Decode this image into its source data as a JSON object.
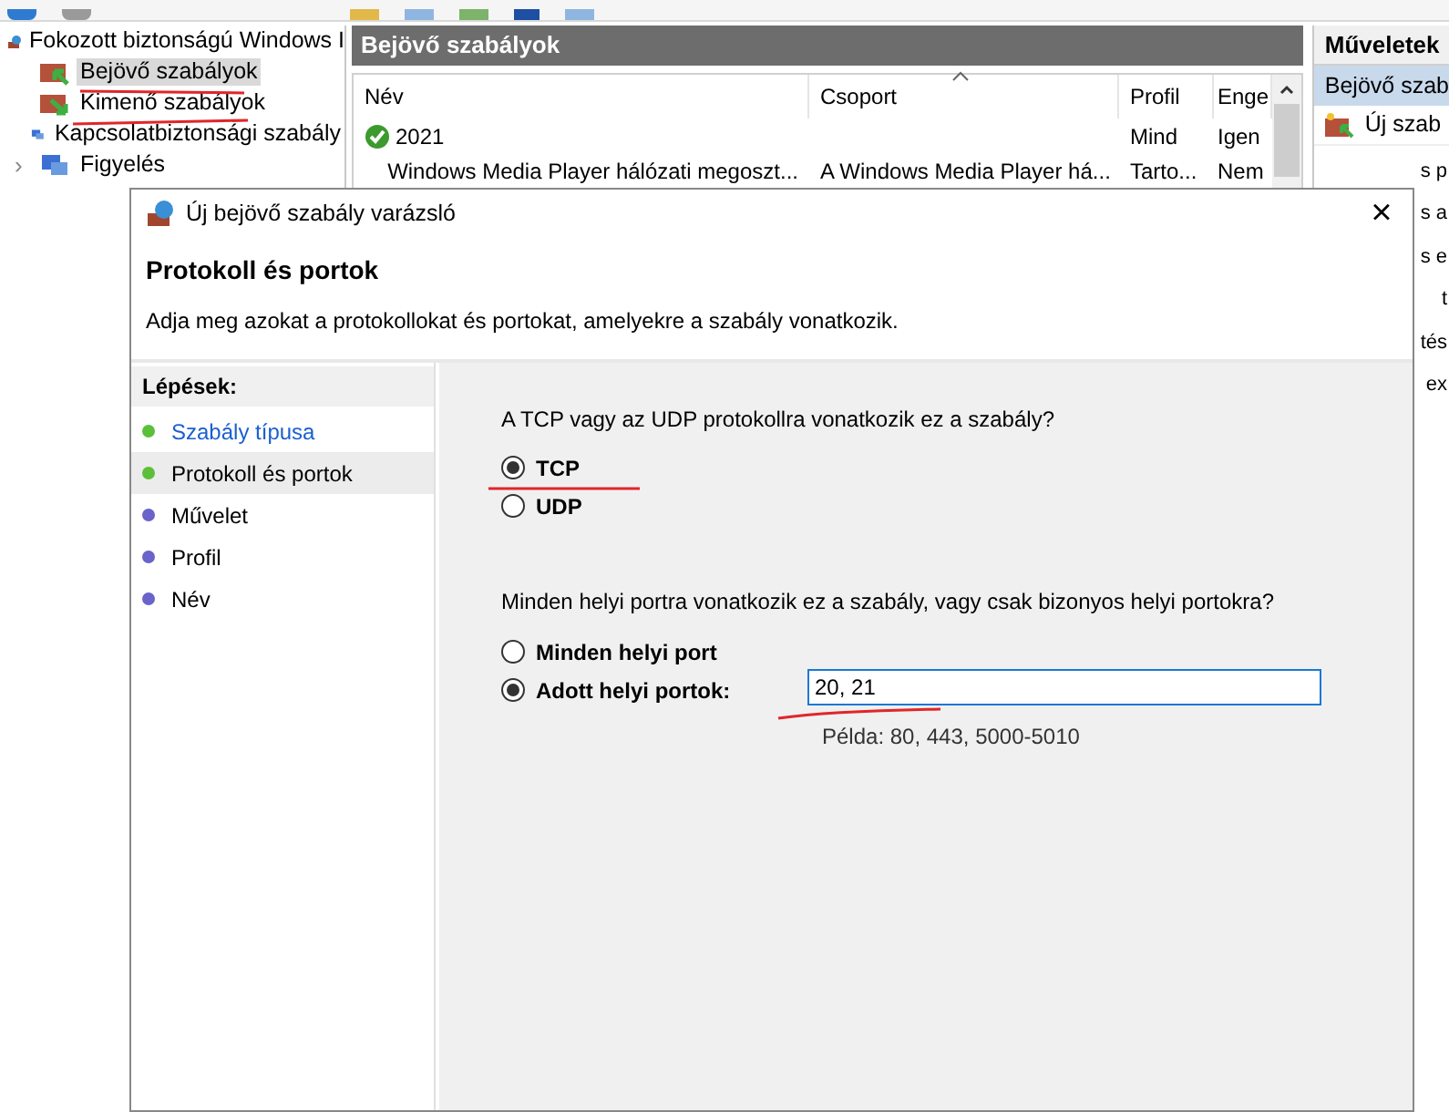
{
  "tree": {
    "root": "Fokozott biztonságú Windows I",
    "items": [
      {
        "label": "Bejövő szabályok",
        "selected": true
      },
      {
        "label": "Kimenő szabályok",
        "selected": false
      },
      {
        "label": "Kapcsolatbiztonsági szabály",
        "selected": false
      },
      {
        "label": "Figyelés",
        "selected": false,
        "expander": "›"
      }
    ]
  },
  "rules_panel": {
    "title": "Bejövő szabályok",
    "columns": [
      "Név",
      "Csoport",
      "Profil",
      "Enge"
    ],
    "rows": [
      {
        "cells": [
          "2021",
          "",
          "Mind",
          "Igen"
        ],
        "enabled": true
      },
      {
        "cells": [
          "Windows Media Player hálózati megoszt...",
          "A Windows Media Player há...",
          "Tarto...",
          "Nem"
        ],
        "enabled": false
      }
    ]
  },
  "actions": {
    "title": "Műveletek",
    "section": "Bejövő szab",
    "items": [
      "Új szab"
    ],
    "fragments": [
      "s p",
      "s a",
      "s e",
      "t",
      "tés",
      "ex"
    ]
  },
  "dialog": {
    "title": "Új bejövő szabály varázsló",
    "close": "×",
    "heading": "Protokoll és portok",
    "subtitle": "Adja meg azokat a protokollokat és portokat, amelyekre a szabály vonatkozik.",
    "steps_title": "Lépések:",
    "steps": [
      {
        "label": "Szabály típusa",
        "color": "#5cbf3a",
        "visited": true,
        "selected": false
      },
      {
        "label": "Protokoll és portok",
        "color": "#5cbf3a",
        "visited": false,
        "selected": true
      },
      {
        "label": "Művelet",
        "color": "#6a63c9",
        "visited": false,
        "selected": false
      },
      {
        "label": "Profil",
        "color": "#6a63c9",
        "visited": false,
        "selected": false
      },
      {
        "label": "Név",
        "color": "#6a63c9",
        "visited": false,
        "selected": false
      }
    ],
    "protocol_question": "A TCP vagy az UDP protokollra vonatkozik ez a szabály?",
    "protocols": [
      {
        "label": "TCP",
        "selected": true
      },
      {
        "label": "UDP",
        "selected": false
      }
    ],
    "port_question": "Minden helyi portra vonatkozik ez a szabály, vagy csak bizonyos helyi portokra?",
    "port_options": [
      {
        "label": "Minden helyi port",
        "selected": false
      },
      {
        "label": "Adott helyi portok:",
        "selected": true
      }
    ],
    "ports_value": "20, 21",
    "ports_example": "Példa: 80, 443, 5000-5010"
  }
}
